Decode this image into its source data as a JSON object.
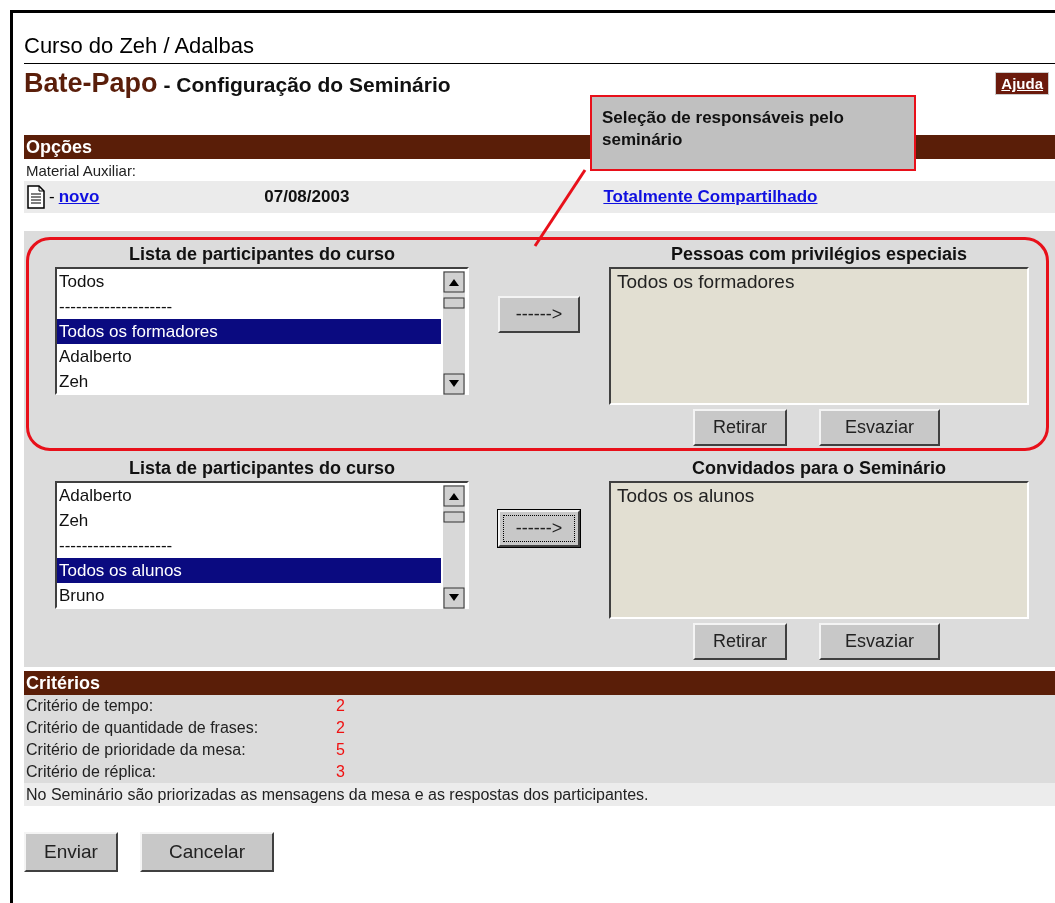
{
  "course_title": "Curso do Zeh / Adalbas",
  "app_name": "Bate-Papo",
  "page_title": "- Configuração do Seminário",
  "help_button": "Ajuda",
  "callout": "Seleção de responsáveis pelo seminário",
  "options": {
    "header": "Opções",
    "material_label": "Material Auxiliar:",
    "separator": "-",
    "link": "novo",
    "date": "07/08/2003",
    "sharing": "Totalmente Compartilhado"
  },
  "selectors": [
    {
      "highlighted": true,
      "source_title": "Lista de participantes do curso",
      "source_items": [
        {
          "label": "Todos",
          "selected": false
        },
        {
          "label": "--------------------",
          "selected": false
        },
        {
          "label": "Todos os formadores",
          "selected": true
        },
        {
          "label": "Adalberto",
          "selected": false
        },
        {
          "label": "Zeh",
          "selected": false
        }
      ],
      "move_button": "------>",
      "move_focused": false,
      "target_title": "Pessoas com privilégios especiais",
      "target_items": [
        "Todos os formadores"
      ],
      "buttons": [
        "Retirar",
        "Esvaziar"
      ]
    },
    {
      "highlighted": false,
      "source_title": "Lista de participantes do curso",
      "source_items": [
        {
          "label": "Adalberto",
          "selected": false
        },
        {
          "label": "Zeh",
          "selected": false
        },
        {
          "label": "--------------------",
          "selected": false
        },
        {
          "label": "Todos os alunos",
          "selected": true
        },
        {
          "label": "Bruno",
          "selected": false
        }
      ],
      "move_button": "------>",
      "move_focused": true,
      "target_title": "Convidados para o Seminário",
      "target_items": [
        "Todos os alunos"
      ],
      "buttons": [
        "Retirar",
        "Esvaziar"
      ]
    }
  ],
  "criteria": {
    "header": "Critérios",
    "rows": [
      {
        "label": "Critério de tempo:",
        "value": "2"
      },
      {
        "label": "Critério de quantidade de frases:",
        "value": "2"
      },
      {
        "label": "Critério de prioridade da mesa:",
        "value": "5"
      },
      {
        "label": "Critério de réplica:",
        "value": "3"
      }
    ],
    "note": "No Seminário são priorizadas as mensagens da mesa e as respostas dos participantes."
  },
  "actions": [
    "Enviar",
    "Cancelar"
  ]
}
